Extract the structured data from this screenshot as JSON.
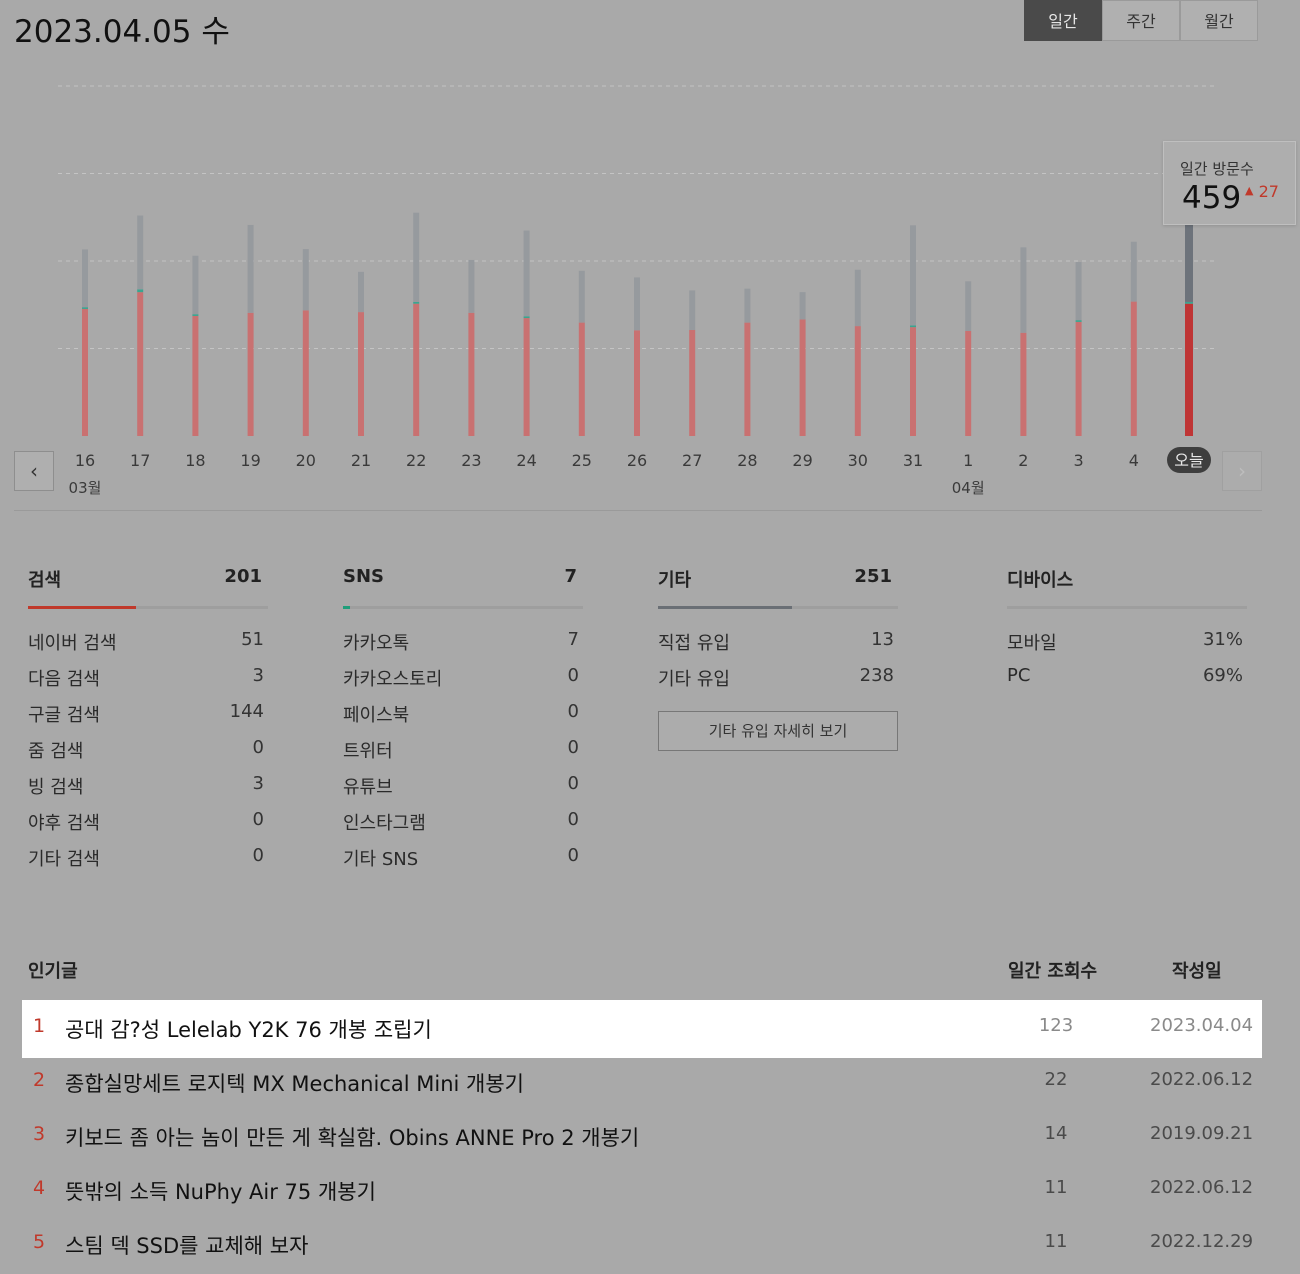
{
  "header": {
    "date": "2023.04.05 수"
  },
  "period_tabs": [
    "일간",
    "주간",
    "월간"
  ],
  "active_period": "일간",
  "chart_data": {
    "type": "bar",
    "categories": [
      "16",
      "17",
      "18",
      "19",
      "20",
      "21",
      "22",
      "23",
      "24",
      "25",
      "26",
      "27",
      "28",
      "29",
      "30",
      "31",
      "1",
      "2",
      "3",
      "4",
      "오늘"
    ],
    "month_labels": [
      {
        "at": "16",
        "label": "03월"
      },
      {
        "at": "1",
        "label": "04월"
      }
    ],
    "series": [
      {
        "values": [
          363,
          411,
          343,
          352,
          359,
          354,
          378,
          352,
          337,
          324,
          302,
          303,
          324,
          333,
          314,
          311,
          300,
          295,
          326,
          384,
          378
        ]
      },
      {
        "values": [
          5,
          8,
          5,
          0,
          0,
          0,
          5,
          0,
          5,
          0,
          0,
          0,
          0,
          0,
          0,
          5,
          0,
          0,
          5,
          0,
          5
        ]
      },
      {
        "values": [
          165,
          211,
          167,
          251,
          175,
          115,
          255,
          151,
          245,
          148,
          151,
          113,
          97,
          78,
          161,
          286,
          142,
          244,
          166,
          171,
          315
        ]
      }
    ],
    "highlight": "오늘",
    "colors": {
      "past_bottom": "#c97171",
      "past_top": "#969a9e",
      "mid": "#3aa590",
      "today_bottom": "#bf3535",
      "today_top": "#6d737b"
    }
  },
  "tooltip": {
    "label": "일간 방문수",
    "value": "459",
    "delta": "27"
  },
  "stats": {
    "search": {
      "title": "검색",
      "total": "201",
      "fill": 0.45,
      "color": "#c0392b",
      "rows": [
        {
          "label": "네이버 검색",
          "value": "51"
        },
        {
          "label": "다음 검색",
          "value": "3"
        },
        {
          "label": "구글 검색",
          "value": "144"
        },
        {
          "label": "줌 검색",
          "value": "0"
        },
        {
          "label": "빙 검색",
          "value": "3"
        },
        {
          "label": "야후 검색",
          "value": "0"
        },
        {
          "label": "기타 검색",
          "value": "0"
        }
      ]
    },
    "sns": {
      "title": "SNS",
      "total": "7",
      "fill": 0.03,
      "color": "#1f9e7a",
      "rows": [
        {
          "label": "카카오톡",
          "value": "7"
        },
        {
          "label": "카카오스토리",
          "value": "0"
        },
        {
          "label": "페이스북",
          "value": "0"
        },
        {
          "label": "트위터",
          "value": "0"
        },
        {
          "label": "유튜브",
          "value": "0"
        },
        {
          "label": "인스타그램",
          "value": "0"
        },
        {
          "label": "기타 SNS",
          "value": "0"
        }
      ]
    },
    "other": {
      "title": "기타",
      "total": "251",
      "fill": 0.56,
      "color": "#6a6f75",
      "rows": [
        {
          "label": "직접 유입",
          "value": "13"
        },
        {
          "label": "기타 유입",
          "value": "238"
        }
      ],
      "button": "기타 유입 자세히 보기"
    },
    "device": {
      "title": "디바이스",
      "total": "",
      "fill": 0,
      "color": "#999999",
      "rows": [
        {
          "label": "모바일",
          "value": "31%"
        },
        {
          "label": "PC",
          "value": "69%"
        }
      ]
    }
  },
  "popular": {
    "title": "인기글",
    "col_views": "일간 조회수",
    "col_date": "작성일",
    "items": [
      {
        "rank": "1",
        "title": "공대 감?성 Lelelab Y2K 76 개봉 조립기",
        "views": "123",
        "date": "2023.04.04"
      },
      {
        "rank": "2",
        "title": "종합실망세트 로지텍 MX Mechanical Mini 개봉기",
        "views": "22",
        "date": "2022.06.12"
      },
      {
        "rank": "3",
        "title": "키보드 좀 아는 놈이 만든 게 확실함. Obins ANNE Pro 2 개봉기",
        "views": "14",
        "date": "2019.09.21"
      },
      {
        "rank": "4",
        "title": "뜻밖의 소득 NuPhy Air 75 개봉기",
        "views": "11",
        "date": "2022.06.12"
      },
      {
        "rank": "5",
        "title": "스팀 덱 SSD를 교체해 보자",
        "views": "11",
        "date": "2022.12.29"
      }
    ]
  }
}
